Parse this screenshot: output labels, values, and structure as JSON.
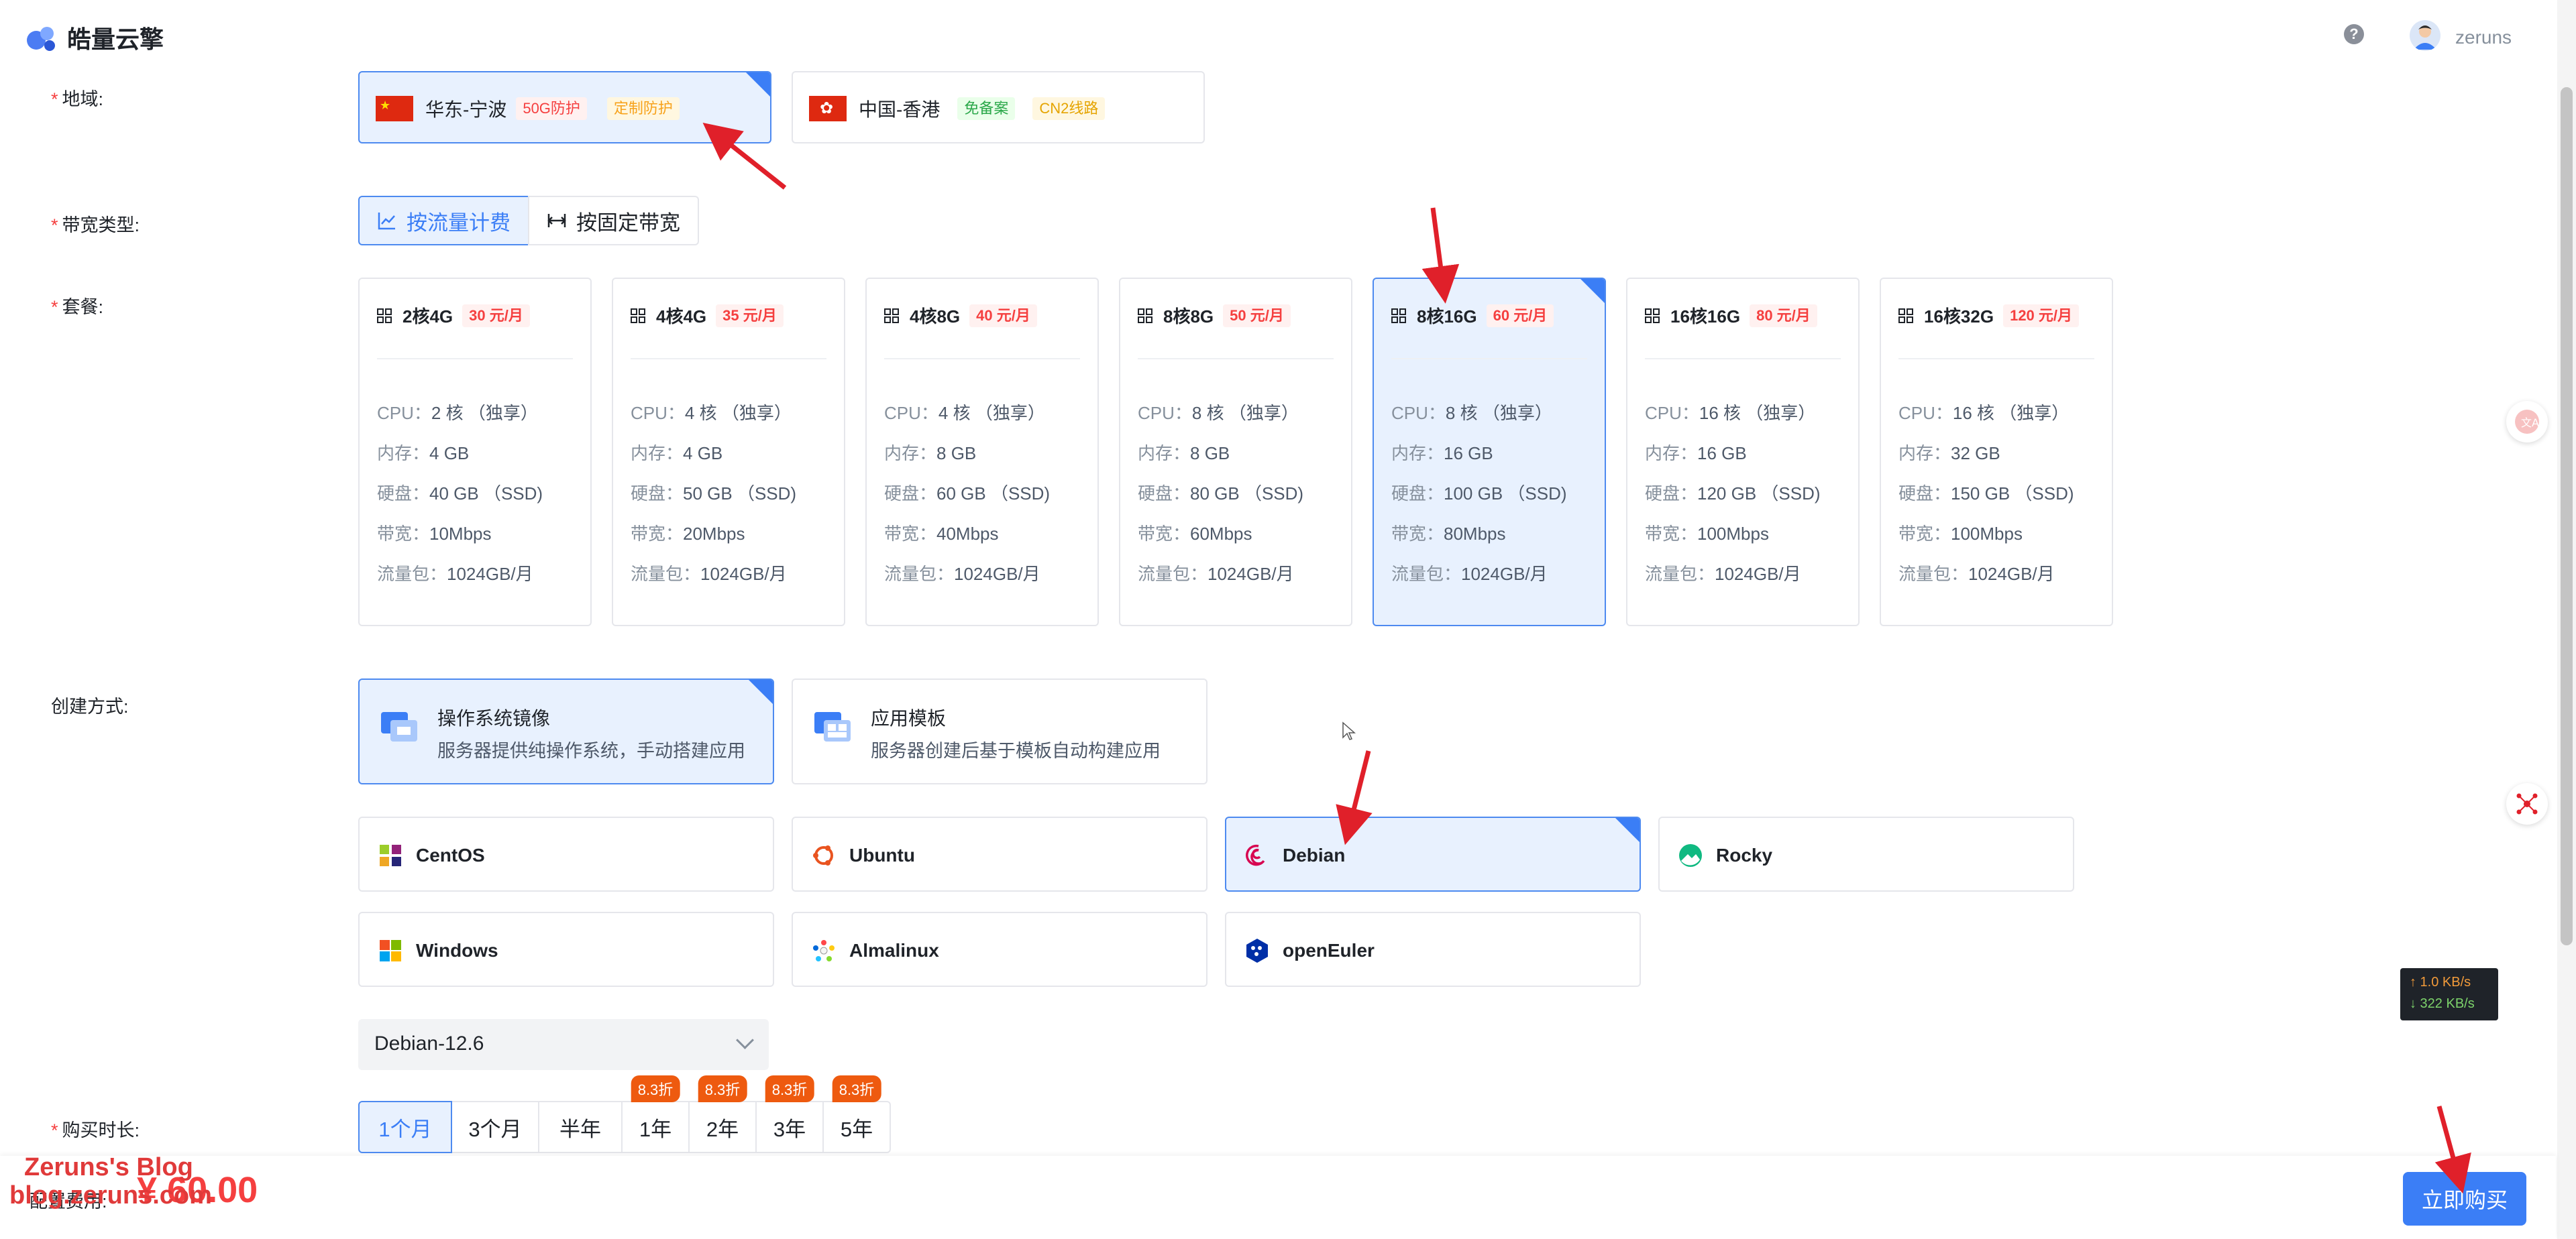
{
  "header": {
    "brand": "皓量云擎",
    "help_icon": "?",
    "username": "zeruns"
  },
  "labels": {
    "region": "地域:",
    "bandwidth_type": "带宽类型:",
    "package": "套餐:",
    "create_method": "创建方式:",
    "duration": "购买时长:",
    "fee": "配置费用:",
    "required_mark": "*"
  },
  "regions": [
    {
      "name": "华东-宁波",
      "tags": [
        {
          "text": "50G防护",
          "style": "red"
        },
        {
          "text": "定制防护",
          "style": "orange"
        }
      ],
      "selected": true
    },
    {
      "name": "中国-香港",
      "tags": [
        {
          "text": "免备案",
          "style": "green"
        },
        {
          "text": "CN2线路",
          "style": "yellow"
        }
      ],
      "selected": false
    }
  ],
  "bandwidth": [
    {
      "label": "按流量计费",
      "selected": true,
      "icon": "line-chart-icon"
    },
    {
      "label": "按固定带宽",
      "selected": false,
      "icon": "width-icon"
    }
  ],
  "spec_keys": {
    "cpu": "CPU：",
    "mem": "内存：",
    "disk": "硬盘：",
    "bw": "带宽：",
    "traffic": "流量包："
  },
  "packages": [
    {
      "name": "2核4G",
      "price": "30 元/月",
      "cpu": "2 核 （独享）",
      "mem": "4 GB",
      "disk": "40 GB （SSD)",
      "bw": "10Mbps",
      "traffic": "1024GB/月",
      "selected": false
    },
    {
      "name": "4核4G",
      "price": "35 元/月",
      "cpu": "4 核 （独享）",
      "mem": "4 GB",
      "disk": "50 GB （SSD)",
      "bw": "20Mbps",
      "traffic": "1024GB/月",
      "selected": false
    },
    {
      "name": "4核8G",
      "price": "40 元/月",
      "cpu": "4 核 （独享）",
      "mem": "8 GB",
      "disk": "60 GB （SSD)",
      "bw": "40Mbps",
      "traffic": "1024GB/月",
      "selected": false
    },
    {
      "name": "8核8G",
      "price": "50 元/月",
      "cpu": "8 核 （独享）",
      "mem": "8 GB",
      "disk": "80 GB （SSD)",
      "bw": "60Mbps",
      "traffic": "1024GB/月",
      "selected": false
    },
    {
      "name": "8核16G",
      "price": "60 元/月",
      "cpu": "8 核 （独享）",
      "mem": "16 GB",
      "disk": "100 GB （SSD)",
      "bw": "80Mbps",
      "traffic": "1024GB/月",
      "selected": true
    },
    {
      "name": "16核16G",
      "price": "80 元/月",
      "cpu": "16 核 （独享）",
      "mem": "16 GB",
      "disk": "120 GB （SSD)",
      "bw": "100Mbps",
      "traffic": "1024GB/月",
      "selected": false
    },
    {
      "name": "16核32G",
      "price": "120 元/月",
      "cpu": "16 核 （独享）",
      "mem": "32 GB",
      "disk": "150 GB （SSD)",
      "bw": "100Mbps",
      "traffic": "1024GB/月",
      "selected": false
    }
  ],
  "methods": [
    {
      "title": "操作系统镜像",
      "desc": "服务器提供纯操作系统，手动搭建应用",
      "selected": true
    },
    {
      "title": "应用模板",
      "desc": "服务器创建后基于模板自动构建应用",
      "selected": false
    }
  ],
  "os_list": [
    {
      "name": "CentOS",
      "icon": "centos-icon",
      "selected": false
    },
    {
      "name": "Ubuntu",
      "icon": "ubuntu-icon",
      "selected": false
    },
    {
      "name": "Debian",
      "icon": "debian-icon",
      "selected": true
    },
    {
      "name": "Rocky",
      "icon": "rocky-icon",
      "selected": false
    },
    {
      "name": "Windows",
      "icon": "windows-icon",
      "selected": false
    },
    {
      "name": "Almalinux",
      "icon": "almalinux-icon",
      "selected": false
    },
    {
      "name": "openEuler",
      "icon": "openeuler-icon",
      "selected": false
    }
  ],
  "os_version": "Debian-12.6",
  "durations": [
    {
      "label": "1个月",
      "discount": "",
      "selected": true
    },
    {
      "label": "3个月",
      "discount": "",
      "selected": false
    },
    {
      "label": "半年",
      "discount": "",
      "selected": false
    },
    {
      "label": "1年",
      "discount": "8.3折",
      "selected": false
    },
    {
      "label": "2年",
      "discount": "8.3折",
      "selected": false
    },
    {
      "label": "3年",
      "discount": "8.3折",
      "selected": false
    },
    {
      "label": "5年",
      "discount": "8.3折",
      "selected": false
    }
  ],
  "footer": {
    "price": "¥ 60.00",
    "buy_label": "立即购买"
  },
  "watermark": {
    "line1": "Zeruns's Blog",
    "line2": "blog.zeruns.com"
  },
  "netspeed": {
    "up": "↑ 1.0 KB/s",
    "down": "↓ 322 KB/s"
  },
  "colors": {
    "accent": "#3b7ef6",
    "price": "#f53f3f",
    "selected_bg": "#e8f1fe",
    "annotation_arrow": "#e0202a"
  }
}
